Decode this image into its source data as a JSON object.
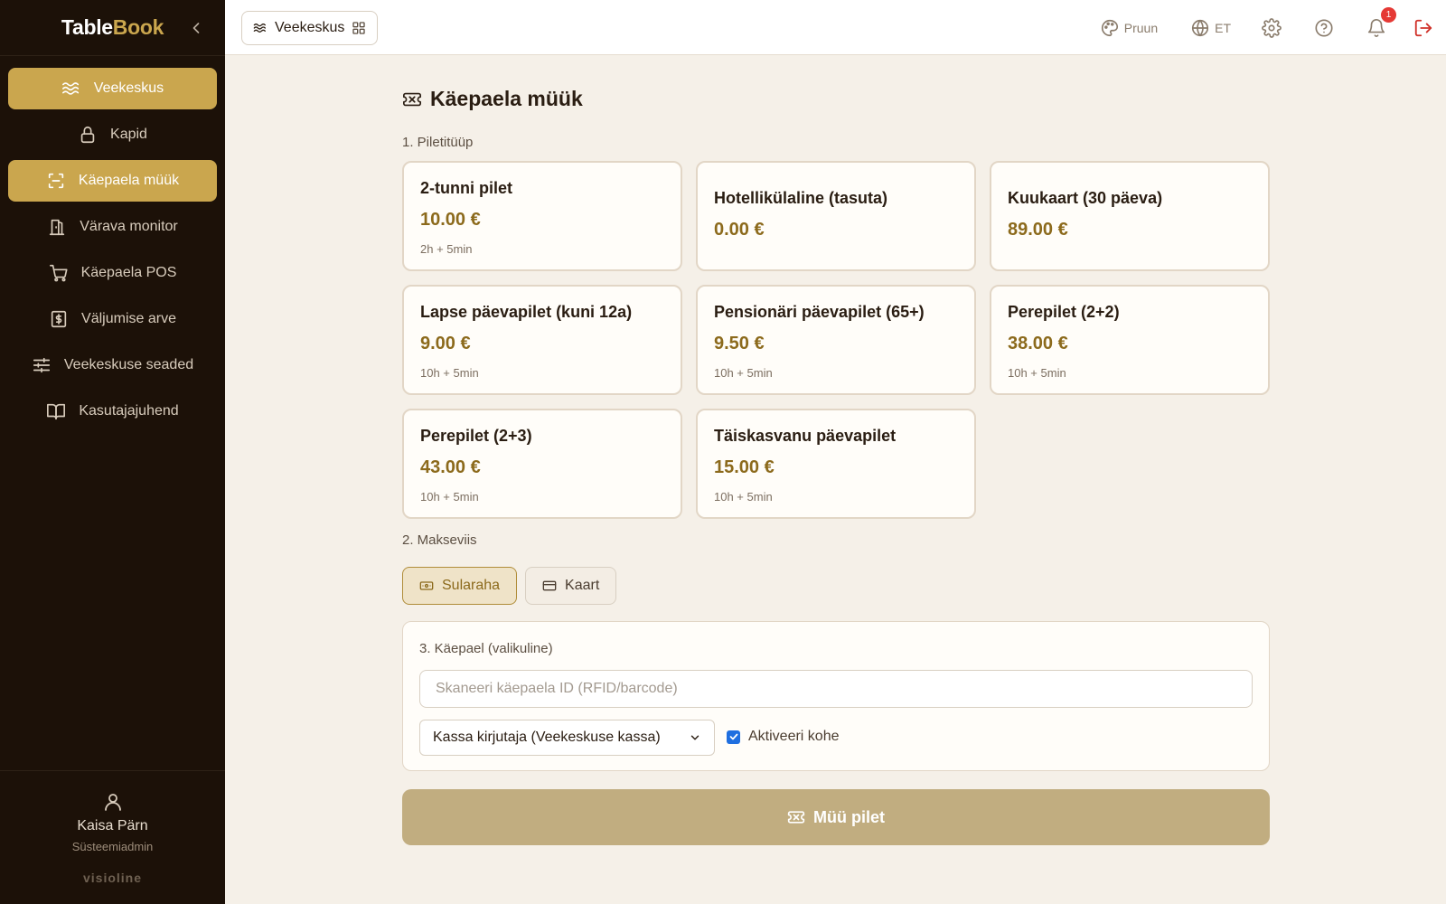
{
  "brand": {
    "part1": "Table",
    "part2": "Book"
  },
  "sidebar": {
    "items": [
      {
        "label": "Veekeskus",
        "icon": "waves-icon",
        "active": true
      },
      {
        "label": "Kapid",
        "icon": "lock-icon",
        "active": false
      },
      {
        "label": "Käepaela müük",
        "icon": "scan-icon",
        "active": true
      },
      {
        "label": "Värava monitor",
        "icon": "door-icon",
        "active": false
      },
      {
        "label": "Käepaela POS",
        "icon": "cart-icon",
        "active": false
      },
      {
        "label": "Väljumise arve",
        "icon": "receipt-icon",
        "active": false
      },
      {
        "label": "Veekeskuse seaded",
        "icon": "sliders-icon",
        "active": false
      },
      {
        "label": "Kasutajajuhend",
        "icon": "book-icon",
        "active": false
      }
    ],
    "user": {
      "name": "Kaisa Pärn",
      "role": "Süsteemiadmin"
    },
    "footer_brand": "visioline"
  },
  "topbar": {
    "venue": "Veekeskus",
    "theme_label": "Pruun",
    "lang_label": "ET",
    "notification_count": "1"
  },
  "main": {
    "title": "Käepaela müük",
    "step1": "1. Piletitüüp",
    "tickets": [
      {
        "name": "2-tunni pilet",
        "price": "10.00 €",
        "duration": "2h + 5min"
      },
      {
        "name": "Hotellikülaline (tasuta)",
        "price": "0.00 €",
        "duration": ""
      },
      {
        "name": "Kuukaart (30 päeva)",
        "price": "89.00 €",
        "duration": ""
      },
      {
        "name": "Lapse päevapilet (kuni 12a)",
        "price": "9.00 €",
        "duration": "10h + 5min"
      },
      {
        "name": "Pensionäri päevapilet (65+)",
        "price": "9.50 €",
        "duration": "10h + 5min"
      },
      {
        "name": "Perepilet (2+2)",
        "price": "38.00 €",
        "duration": "10h + 5min"
      },
      {
        "name": "Perepilet (2+3)",
        "price": "43.00 €",
        "duration": "10h + 5min"
      },
      {
        "name": "Täiskasvanu päevapilet",
        "price": "15.00 €",
        "duration": "10h + 5min"
      }
    ],
    "step2": "2. Makseviis",
    "payment": {
      "cash": "Sularaha",
      "card": "Kaart",
      "selected": "cash"
    },
    "step3": "3. Käepael (valikuline)",
    "wristband_placeholder": "Skaneeri käepaela ID (RFID/barcode)",
    "kassa_selected": "Kassa kirjutaja (Veekeskuse kassa)",
    "activate_label": "Aktiveeri kohe",
    "activate_checked": true,
    "sell_label": "Müü pilet"
  },
  "colors": {
    "accent": "#caa64e",
    "sidebar_bg": "#1c1108",
    "price": "#8c6a1c",
    "sell_button": "#c1ad80"
  }
}
